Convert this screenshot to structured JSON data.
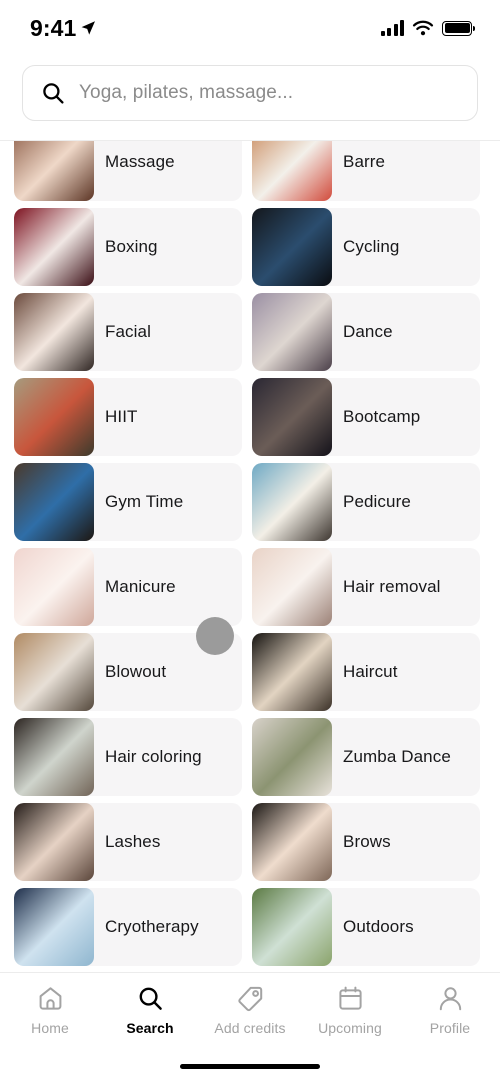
{
  "status_bar": {
    "time": "9:41",
    "location_icon": "location-arrow-icon",
    "signal_icon": "cellular-signal-icon",
    "wifi_icon": "wifi-icon",
    "battery_icon": "battery-full-icon"
  },
  "search": {
    "icon": "search-icon",
    "placeholder": "Yoga, pilates, massage...",
    "value": ""
  },
  "categories": [
    {
      "label": "Massage",
      "image": "massage-thumbnail",
      "c1": "#8a5a44",
      "c2": "#efd8c8",
      "c3": "#5c3525"
    },
    {
      "label": "Barre",
      "image": "barre-thumbnail",
      "c1": "#c98a5d",
      "c2": "#f3f0ea",
      "c3": "#d14b3c"
    },
    {
      "label": "Boxing",
      "image": "boxing-thumbnail",
      "c1": "#7d1220",
      "c2": "#f0e7e4",
      "c3": "#3a0d14"
    },
    {
      "label": "Cycling",
      "image": "cycling-thumbnail",
      "c1": "#14171c",
      "c2": "#2b4d6e",
      "c3": "#0a0c10"
    },
    {
      "label": "Facial",
      "image": "facial-thumbnail",
      "c1": "#6b4a3c",
      "c2": "#f2e6de",
      "c3": "#2f2623"
    },
    {
      "label": "Dance",
      "image": "dance-thumbnail",
      "c1": "#9a8fa3",
      "c2": "#ded6d0",
      "c3": "#4b3f49"
    },
    {
      "label": "HIIT",
      "image": "hiit-thumbnail",
      "c1": "#a69b7e",
      "c2": "#c8563c",
      "c3": "#3d3a2c"
    },
    {
      "label": "Bootcamp",
      "image": "bootcamp-thumbnail",
      "c1": "#2a2733",
      "c2": "#6b5d57",
      "c3": "#14121a"
    },
    {
      "label": "Gym Time",
      "image": "gym-time-thumbnail",
      "c1": "#4a392b",
      "c2": "#2f6ea8",
      "c3": "#1d1712"
    },
    {
      "label": "Pedicure",
      "image": "pedicure-thumbnail",
      "c1": "#6fa9c4",
      "c2": "#f3efe6",
      "c3": "#3d3630"
    },
    {
      "label": "Manicure",
      "image": "manicure-thumbnail",
      "c1": "#f0d5cf",
      "c2": "#fbf3ef",
      "c3": "#cfa79a"
    },
    {
      "label": "Hair removal",
      "image": "hair-removal-thumbnail",
      "c1": "#e9d3c7",
      "c2": "#f8f2ee",
      "c3": "#9b8176"
    },
    {
      "label": "Blowout",
      "image": "blowout-thumbnail",
      "c1": "#b08a63",
      "c2": "#e7dfd6",
      "c3": "#54483c"
    },
    {
      "label": "Haircut",
      "image": "haircut-thumbnail",
      "c1": "#15120f",
      "c2": "#e2d4c2",
      "c3": "#3b3128"
    },
    {
      "label": "Hair coloring",
      "image": "hair-coloring-thumbnail",
      "c1": "#2b2420",
      "c2": "#cfd4cc",
      "c3": "#716457"
    },
    {
      "label": "Zumba Dance",
      "image": "zumba-dance-thumbnail",
      "c1": "#d8d2ca",
      "c2": "#8c9472",
      "c3": "#e8e2db"
    },
    {
      "label": "Lashes",
      "image": "lashes-thumbnail",
      "c1": "#241c18",
      "c2": "#e6d2c4",
      "c3": "#5a453a"
    },
    {
      "label": "Brows",
      "image": "brows-thumbnail",
      "c1": "#1b1714",
      "c2": "#efdccd",
      "c3": "#7d6657"
    },
    {
      "label": "Cryotherapy",
      "image": "cryotherapy-thumbnail",
      "c1": "#1e2e4a",
      "c2": "#cfe2ef",
      "c3": "#8fb6cf"
    },
    {
      "label": "Outdoors",
      "image": "outdoors-thumbnail",
      "c1": "#5b7a43",
      "c2": "#cfe0d4",
      "c3": "#8aa36b"
    }
  ],
  "cursor": {
    "name": "touch-pointer"
  },
  "tabs": [
    {
      "label": "Home",
      "icon": "home-icon",
      "active": false
    },
    {
      "label": "Search",
      "icon": "search-icon",
      "active": true
    },
    {
      "label": "Add credits",
      "icon": "tag-icon",
      "active": false
    },
    {
      "label": "Upcoming",
      "icon": "calendar-icon",
      "active": false
    },
    {
      "label": "Profile",
      "icon": "person-icon",
      "active": false
    }
  ],
  "colors": {
    "card_bg": "#f6f5f6",
    "text": "#18181a",
    "muted": "#a3a3a3",
    "accent": "#000000"
  }
}
